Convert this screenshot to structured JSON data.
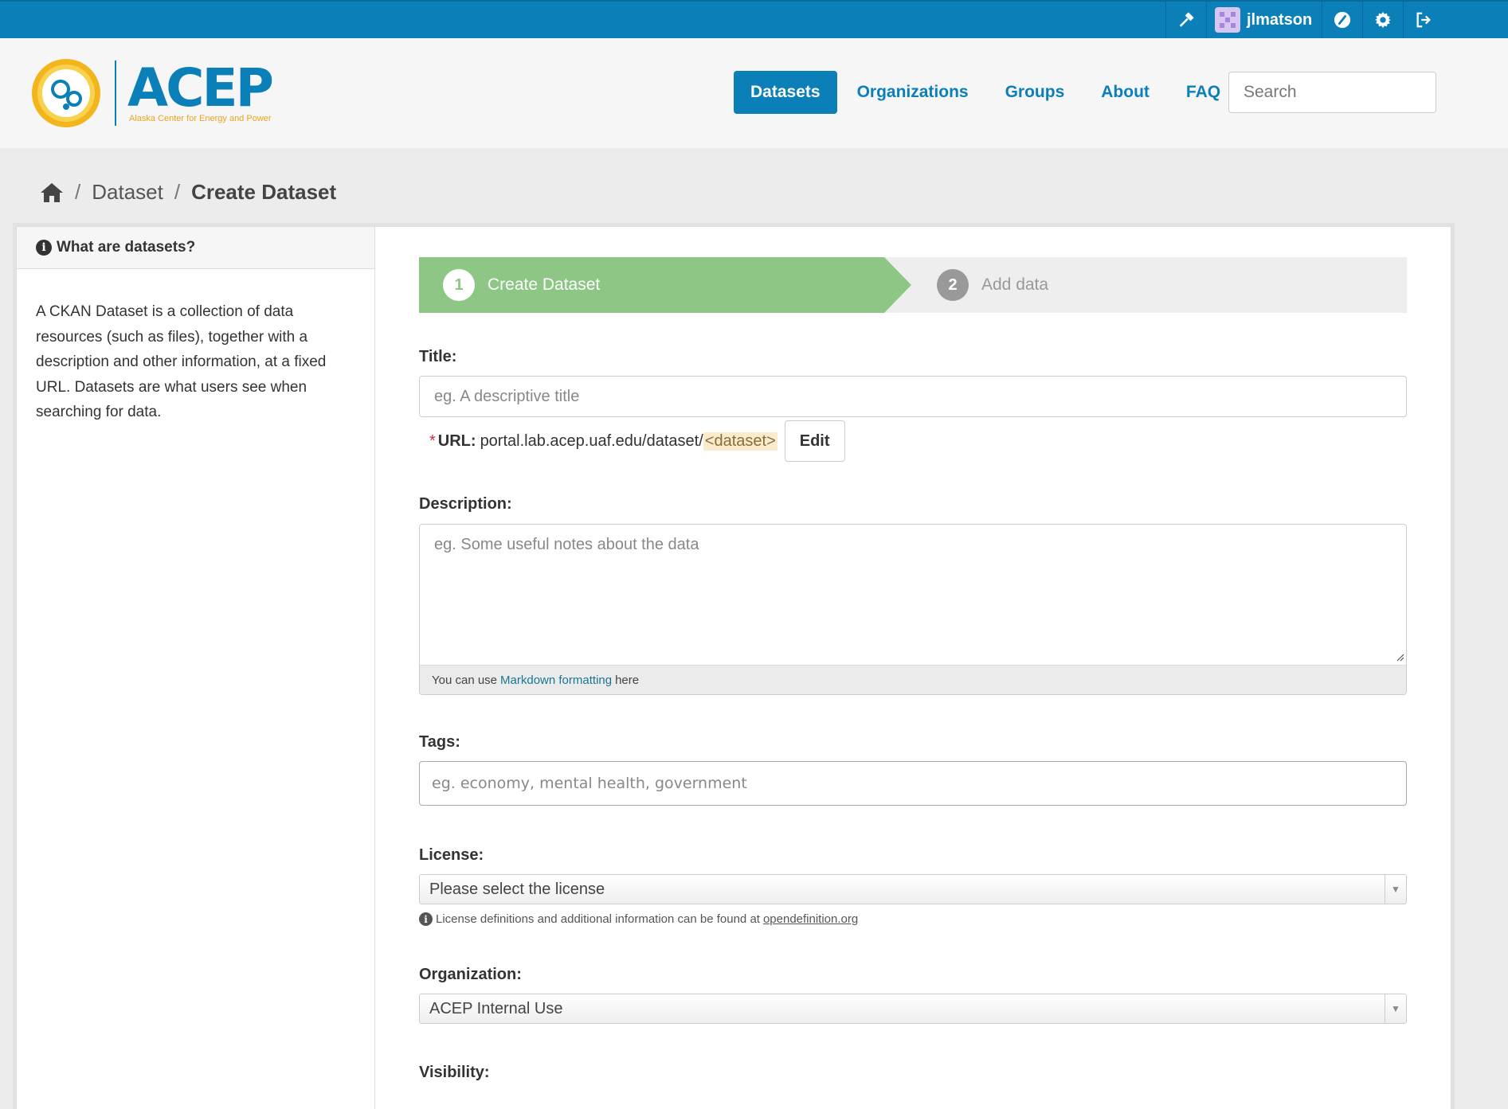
{
  "account": {
    "username": "jlmatson",
    "icons": [
      "admin-hammer-icon",
      "dashboard-icon",
      "settings-gear-icon",
      "logout-icon"
    ]
  },
  "brand": {
    "name": "ACEP",
    "tagline": "Alaska Center for Energy and Power",
    "primary_color": "#0a7fb8",
    "accent_color": "#e8a51d"
  },
  "nav": {
    "items": [
      {
        "label": "Datasets",
        "active": true
      },
      {
        "label": "Organizations",
        "active": false
      },
      {
        "label": "Groups",
        "active": false
      },
      {
        "label": "About",
        "active": false
      },
      {
        "label": "FAQ",
        "active": false
      }
    ],
    "search_placeholder": "Search"
  },
  "breadcrumb": {
    "items": [
      "Dataset",
      "Create Dataset"
    ]
  },
  "sidebar": {
    "heading": "What are datasets?",
    "body": "A CKAN Dataset is a collection of data resources (such as files), together with a description and other information, at a fixed URL. Datasets are what users see when searching for data."
  },
  "stages": [
    {
      "number": "1",
      "label": "Create Dataset",
      "active": true
    },
    {
      "number": "2",
      "label": "Add data",
      "active": false
    }
  ],
  "form": {
    "title": {
      "label": "Title:",
      "placeholder": "eg. A descriptive title"
    },
    "url": {
      "required_mark": "*",
      "label": "URL:",
      "prefix": "portal.lab.acep.uaf.edu/dataset/",
      "slug": "<dataset>",
      "edit_label": "Edit"
    },
    "description": {
      "label": "Description:",
      "placeholder": "eg. Some useful notes about the data",
      "help_before": "You can use",
      "help_link": "Markdown formatting",
      "help_after": "here"
    },
    "tags": {
      "label": "Tags:",
      "placeholder": "eg. economy, mental health, government"
    },
    "license": {
      "label": "License:",
      "selected": "Please select the license",
      "hint_text": "License definitions and additional information can be found at",
      "hint_link": "opendefinition.org"
    },
    "organization": {
      "label": "Organization:",
      "selected": "ACEP Internal Use"
    },
    "visibility": {
      "label": "Visibility:"
    }
  }
}
